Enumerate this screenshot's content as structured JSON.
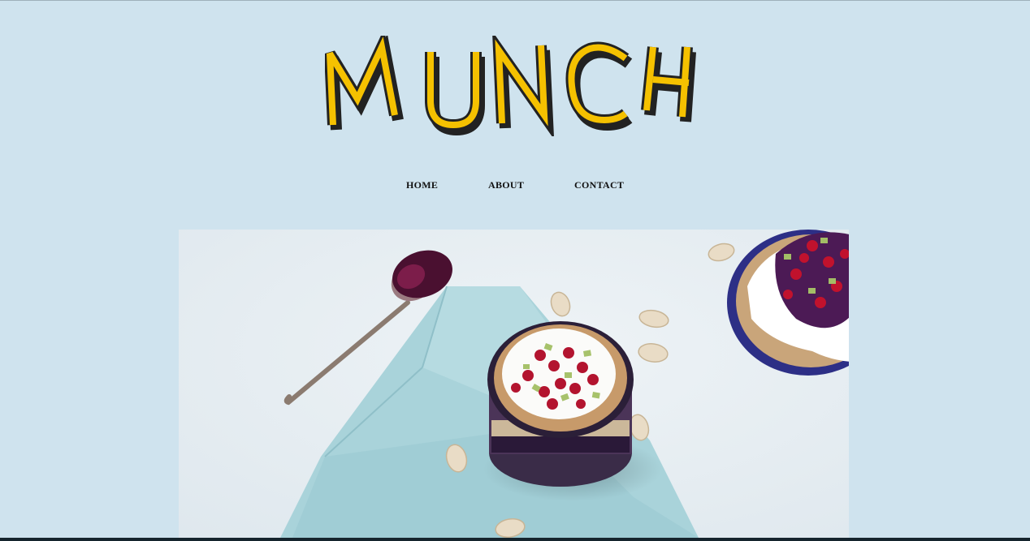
{
  "brand": {
    "logo_text": "MUNCH",
    "logo_fill": "#f5c100",
    "logo_outline": "#222222"
  },
  "nav": {
    "items": [
      {
        "label": "HOME"
      },
      {
        "label": "ABOUT"
      },
      {
        "label": "CONTACT"
      }
    ]
  },
  "page": {
    "background": "#cfe3ee"
  },
  "hero": {
    "image_subject": "yogurt-parfait-photo"
  }
}
